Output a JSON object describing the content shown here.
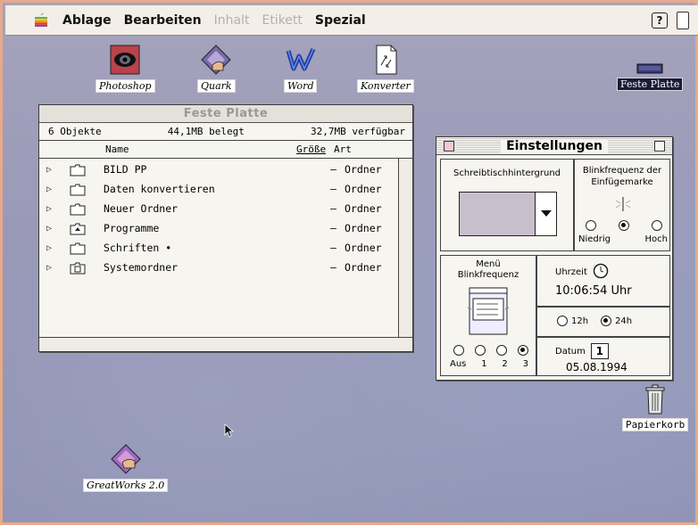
{
  "menubar": {
    "items": [
      {
        "label": "Ablage",
        "enabled": true
      },
      {
        "label": "Bearbeiten",
        "enabled": true
      },
      {
        "label": "Inhalt",
        "enabled": false
      },
      {
        "label": "Etikett",
        "enabled": false
      },
      {
        "label": "Spezial",
        "enabled": true
      }
    ],
    "help_label": "?"
  },
  "desktop_icons": {
    "photoshop": "Photoshop",
    "quark": "Quark",
    "word": "Word",
    "konverter": "Konverter",
    "disk": "Feste Platte",
    "trash": "Papierkorb",
    "greatworks": "GreatWorks 2.0"
  },
  "finder_window": {
    "title": "Feste Platte",
    "objects": "6 Objekte",
    "used": "44,1MB belegt",
    "free": "32,7MB verfügbar",
    "columns": {
      "name": "Name",
      "size": "Größe",
      "kind": "Art"
    },
    "rows": [
      {
        "name": "BILD PP",
        "size": "–",
        "kind": "Ordner",
        "icon": "folder-icon"
      },
      {
        "name": "Daten konvertieren",
        "size": "–",
        "kind": "Ordner",
        "icon": "folder-icon"
      },
      {
        "name": "Neuer Ordner",
        "size": "–",
        "kind": "Ordner",
        "icon": "folder-icon"
      },
      {
        "name": "Programme",
        "size": "–",
        "kind": "Ordner",
        "icon": "applications-folder-icon"
      },
      {
        "name": "Schriften •",
        "size": "–",
        "kind": "Ordner",
        "icon": "folder-icon"
      },
      {
        "name": "Systemordner",
        "size": "–",
        "kind": "Ordner",
        "icon": "system-folder-icon"
      }
    ]
  },
  "settings": {
    "title": "Einstellungen",
    "desktop_bg_label": "Schreibtischhintergrund",
    "blink_caret_label": "Blinkfrequenz der Einfügemarke",
    "blink_caret_options": [
      "Niedrig",
      "",
      "Hoch"
    ],
    "blink_caret_selected": 1,
    "menu_blink_label": "Menü Blinkfrequenz",
    "menu_blink_options": [
      "Aus",
      "1",
      "2",
      "3"
    ],
    "menu_blink_selected": 3,
    "time_label": "Uhrzeit",
    "time_value": "10:06:54 Uhr",
    "clock_options": [
      "12h",
      "24h"
    ],
    "clock_selected": 1,
    "date_label": "Datum",
    "date_value": "05.08.1994",
    "calendar_day": "1"
  },
  "colors": {
    "menubar": "#f3efe8",
    "desktop": "#9a9ab8",
    "window": "#f7f5f0",
    "screen_border": "#e7a98a"
  }
}
